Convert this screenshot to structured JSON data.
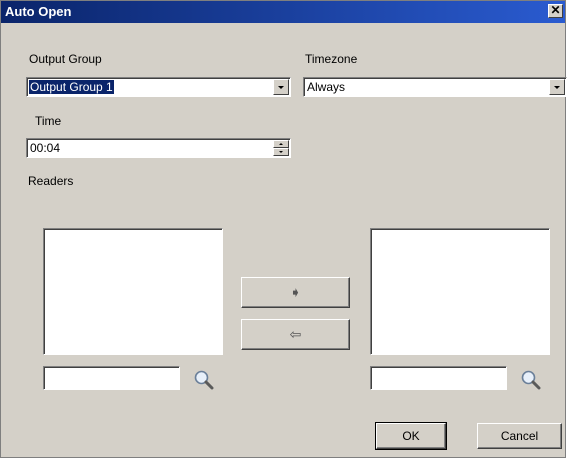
{
  "window": {
    "title": "Auto Open",
    "close_glyph": "✕"
  },
  "output_group": {
    "label": "Output  Group",
    "value": "Output Group 1"
  },
  "timezone": {
    "label": "Timezone",
    "value": "Always"
  },
  "time": {
    "label": "Time",
    "value": "00:04"
  },
  "readers": {
    "label": "Readers"
  },
  "buttons": {
    "move_right": "➧",
    "move_left": "⇦",
    "ok": "OK",
    "cancel": "Cancel"
  },
  "colors": {
    "face": "#d4d0c8",
    "title_bar": "#0a246a",
    "selection": "#0a246a"
  }
}
